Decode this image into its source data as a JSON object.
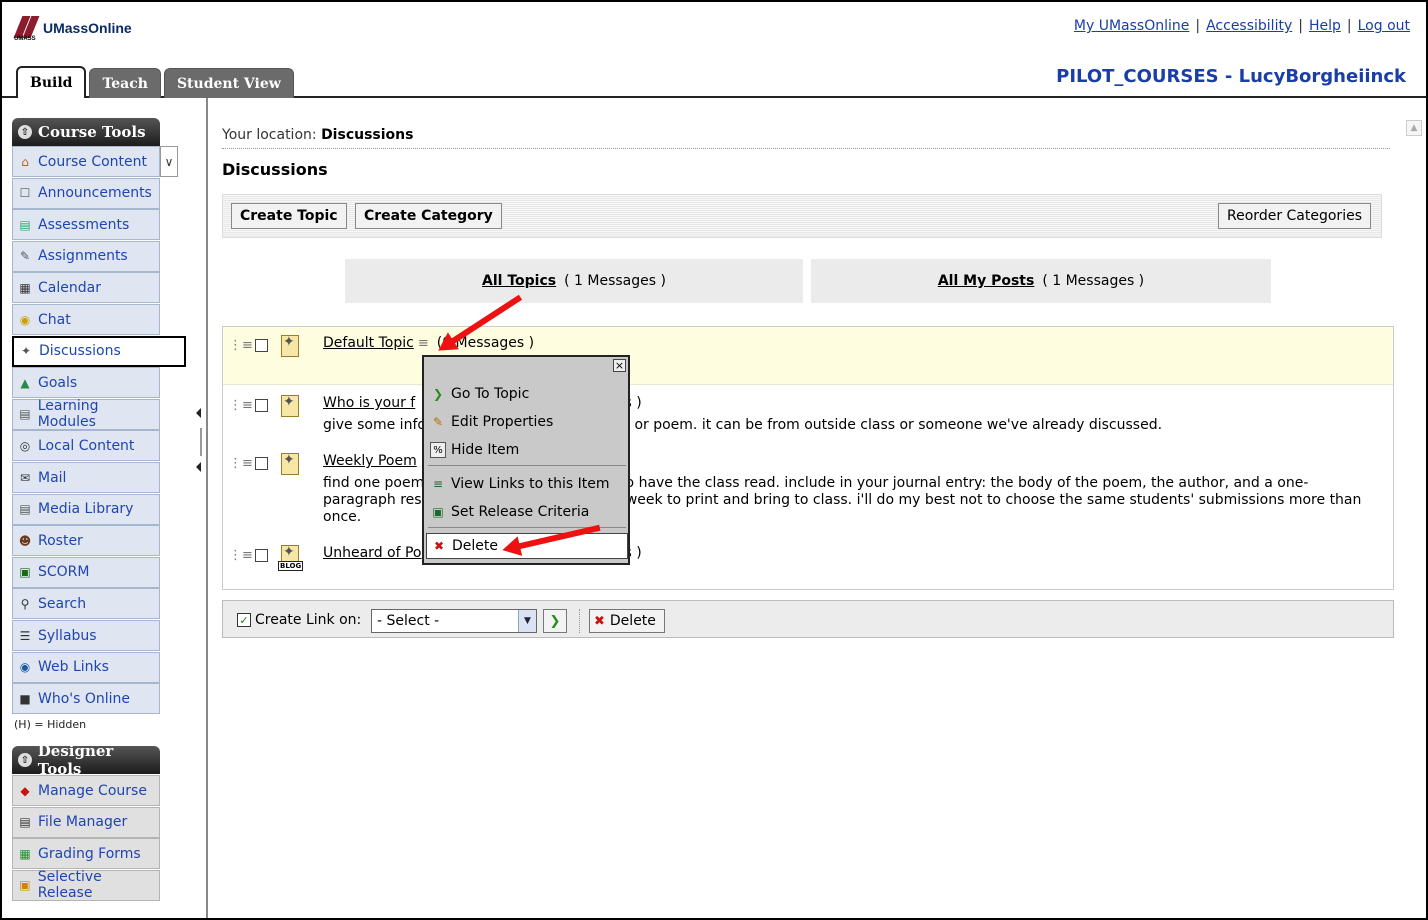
{
  "header": {
    "logo_text": "UMassOnline",
    "logo_small": "UMASS",
    "links": [
      "My UMassOnline",
      "Accessibility",
      "Help",
      "Log out"
    ],
    "course_title": "PILOT_COURSES - LucyBorgheiinck",
    "tabs": [
      "Build",
      "Teach",
      "Student View"
    ]
  },
  "sidebar": {
    "course_tools_title": "Course Tools",
    "course_tools": [
      {
        "label": "Course Content",
        "icon": "home-icon"
      },
      {
        "label": "Announcements",
        "icon": "megaphone-icon"
      },
      {
        "label": "Assessments",
        "icon": "assessment-icon"
      },
      {
        "label": "Assignments",
        "icon": "assignment-icon"
      },
      {
        "label": "Calendar",
        "icon": "calendar-icon"
      },
      {
        "label": "Chat",
        "icon": "chat-icon"
      },
      {
        "label": "Discussions",
        "icon": "pushpin-icon"
      },
      {
        "label": "Goals",
        "icon": "goals-icon"
      },
      {
        "label": "Learning Modules",
        "icon": "modules-icon"
      },
      {
        "label": "Local Content",
        "icon": "disc-icon"
      },
      {
        "label": "Mail",
        "icon": "mail-icon"
      },
      {
        "label": "Media Library",
        "icon": "media-icon"
      },
      {
        "label": "Roster",
        "icon": "people-icon"
      },
      {
        "label": "SCORM",
        "icon": "scorm-icon"
      },
      {
        "label": "Search",
        "icon": "search-icon"
      },
      {
        "label": "Syllabus",
        "icon": "syllabus-icon"
      },
      {
        "label": "Web Links",
        "icon": "globe-icon"
      },
      {
        "label": "Who's Online",
        "icon": "user-online-icon"
      }
    ],
    "hidden_note": "(H) = Hidden",
    "designer_tools_title": "Designer Tools",
    "designer_tools": [
      {
        "label": "Manage Course",
        "icon": "manage-icon"
      },
      {
        "label": "File Manager",
        "icon": "file-manager-icon"
      },
      {
        "label": "Grading Forms",
        "icon": "grading-icon"
      },
      {
        "label": "Selective Release",
        "icon": "release-icon"
      }
    ]
  },
  "main": {
    "location_label": "Your location:",
    "location_value": "Discussions",
    "page_title": "Discussions",
    "toolbar": {
      "create_topic": "Create Topic",
      "create_category": "Create Category",
      "reorder": "Reorder Categories"
    },
    "views": [
      {
        "label": "All Topics",
        "count": "( 1 Messages )"
      },
      {
        "label": "All My Posts",
        "count": "( 1 Messages )"
      }
    ],
    "topics": [
      {
        "title": "Default Topic",
        "count": "(0 Messages )",
        "desc": ""
      },
      {
        "title": "Who is your f",
        "count": "ges )",
        "desc_left": "give some info",
        "desc_right": "bet or poem. it can be from outside class or someone we've already discussed."
      },
      {
        "title": "Weekly Poem",
        "count": "",
        "desc_left": "find one poem",
        "desc_right": "e to have the class read. include in your journal entry: the body of the poem, the author, and a one-",
        "desc2_left": "paragraph res",
        "desc2_right": "th week to print and bring to class. i'll do my best not to choose the same students' submissions more than",
        "desc3": "once."
      },
      {
        "title": "Unheard of Po",
        "count": "ges )",
        "badge": "BLOG"
      }
    ],
    "context_menu": [
      "Go To Topic",
      "Edit Properties",
      "Hide Item",
      "View Links to this Item",
      "Set Release Criteria",
      "Delete"
    ],
    "bottom": {
      "create_link_label": "Create Link on:",
      "select_value": "- Select -",
      "delete_label": "Delete"
    }
  },
  "colors": {
    "link": "#1a3ea8",
    "highlight_row": "#fefde0",
    "nav_bg": "#dfe6f2",
    "arrow": "#e11111"
  }
}
